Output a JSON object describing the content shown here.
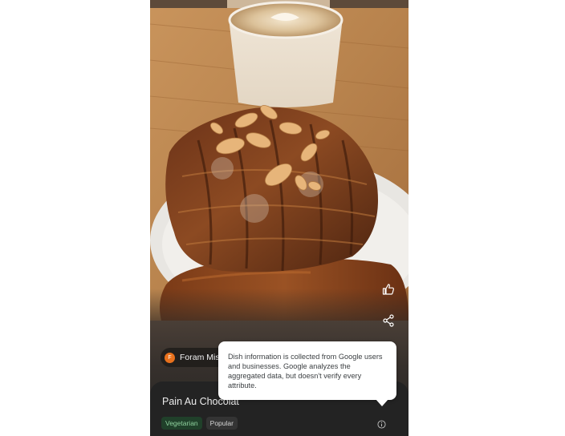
{
  "photo": {
    "subject": "croissant-photo"
  },
  "actions": {
    "like_icon": "thumbs-up-icon",
    "share_icon": "share-icon"
  },
  "author": {
    "avatar_letter": "F",
    "name": "Foram Mistr",
    "avatar_color": "#e8711d"
  },
  "dish": {
    "title": "Pain Au Chocolat",
    "tags": [
      "Vegetarian",
      "Popular"
    ],
    "info_icon": "info-icon"
  },
  "tooltip": {
    "text": "Dish information is collected from Google users and businesses. Google analyzes the aggregated data, but doesn't verify every attribute."
  }
}
